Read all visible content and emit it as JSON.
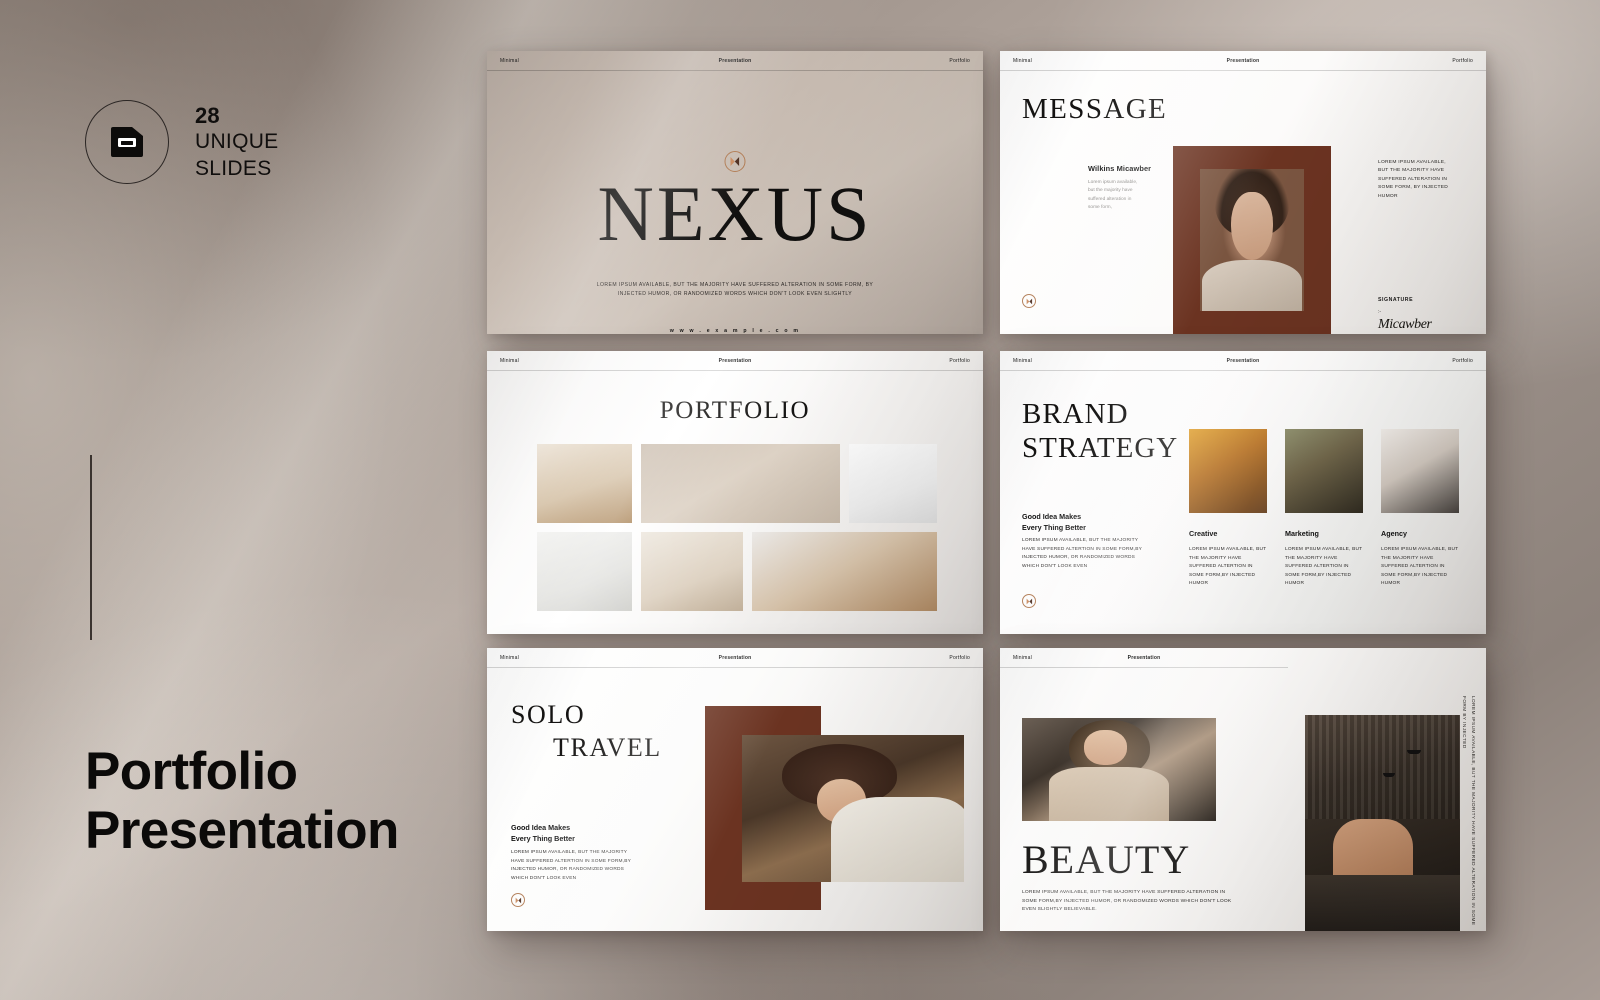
{
  "left_panel": {
    "badge": {
      "icon": "slide-document-icon",
      "count": "28",
      "line1": "UNIQUE",
      "line2": "SLIDES"
    },
    "title_line1": "Portfolio",
    "title_line2": "Presentation"
  },
  "slide_header": {
    "left": "Minimal",
    "center": "Presentation",
    "right": "Portfolio"
  },
  "colors": {
    "accent_brown": "#6b3321",
    "logo_orange": "#c98a5e",
    "logo_dark": "#4a2a1c",
    "background": "#9a8f89",
    "text_dark": "#121212"
  },
  "slides": {
    "nexus": {
      "title": "NEXUS",
      "subtitle": "LOREM IPSUM AVAILABLE, BUT THE MAJORITY HAVE SUFFERED ALTERATION IN SOME FORM, BY INJECTED HUMOR, OR RANDOMIZED WORDS WHICH DON'T LOOK EVEN SLIGHTLY",
      "url": "w w w . e x a m p l e . c o m"
    },
    "message": {
      "title": "MESSAGE",
      "author": "Wilkins Micawber",
      "author_body": "Lorem ipsum available, but the majority have suffered alteration in some form,",
      "right_body": "LOREM IPSUM AVAILABLE, BUT THE MAJORITY HAVE SUFFERED ALTERATION IN SOME FORM, BY INJECTED HUMOR",
      "signature_label": "SIGNATURE",
      "signature_dash": ":-",
      "signature_name": "Micawber",
      "photo_alt": "portrait-woman-makeup"
    },
    "portfolio": {
      "title": "PORTFOLIO",
      "tiles": [
        "dining-table-interior",
        "skincare-bottles-vase",
        "black-mug-pen-notebook",
        "white-vase-plant",
        "laptop-on-desk",
        "beige-sofa-cushions"
      ]
    },
    "brand_strategy": {
      "title_line1": "BRAND",
      "title_line2": "STRATEGY",
      "subheading_line1": "Good Idea Makes",
      "subheading_line2": "Every Thing Better",
      "body": "LOREM IPSUM AVAILABLE, BUT THE MAJORITY HAVE SUFFERED ALTERTION IN SOME FORM,BY INJECTED HUMOR, OR RANDOMIZED WORDS WHICH DON'T LOOK EVEN",
      "columns": [
        {
          "heading": "Creative",
          "body": "LOREM IPSUM AVAILABLE, BUT THE MAJORITY HAVE SUFFERED ALTERTION IN SOME FORM,BY INJECTED HUMOR",
          "image_alt": "woman-yellow-jewelry"
        },
        {
          "heading": "Marketing",
          "body": "LOREM IPSUM AVAILABLE, BUT THE MAJORITY HAVE SUFFERED ALTERTION IN SOME FORM,BY INJECTED HUMOR",
          "image_alt": "woman-earring-profile"
        },
        {
          "heading": "Agency",
          "body": "LOREM IPSUM AVAILABLE, BUT THE MAJORITY HAVE SUFFERED ALTERTION IN SOME FORM,BY INJECTED HUMOR",
          "image_alt": "woman-working-desk"
        }
      ]
    },
    "solo_travel": {
      "title_line1": "SOLO",
      "title_line2": "TRAVEL",
      "subheading_line1": "Good Idea Makes",
      "subheading_line2": "Every Thing Better",
      "body": "LOREM IPSUM AVAILABLE, BUT THE MAJORITY HAVE SUFFERED ALTERTION IN SOME FORM,BY INJECTED HUMOR, OR RANDOMIZED WORDS WHICH DON'T LOOK EVEN",
      "photo_alt": "smiling-woman-hat"
    },
    "beauty": {
      "title": "BEAUTY",
      "body": "LOREM IPSUM AVAILABLE, BUT THE MAJORITY HAVE SUFFERED ALTERATION IN SOME FORM,BY INJECTED HUMOR, OR RANDOMIZED WORDS WHICH DON'T LOOK EVEN SLIGHTLY BELIEVABLE.",
      "vertical_text": "LOREM IPSUM AVAILABLE, BUT THE MAJORITY HAVE SUFFERED ALTERATION IN SOME FORM BY INJECTED",
      "photo_alt": "woman-coffee-coat",
      "photo_right_alt": "dark-lounge-interior"
    }
  }
}
